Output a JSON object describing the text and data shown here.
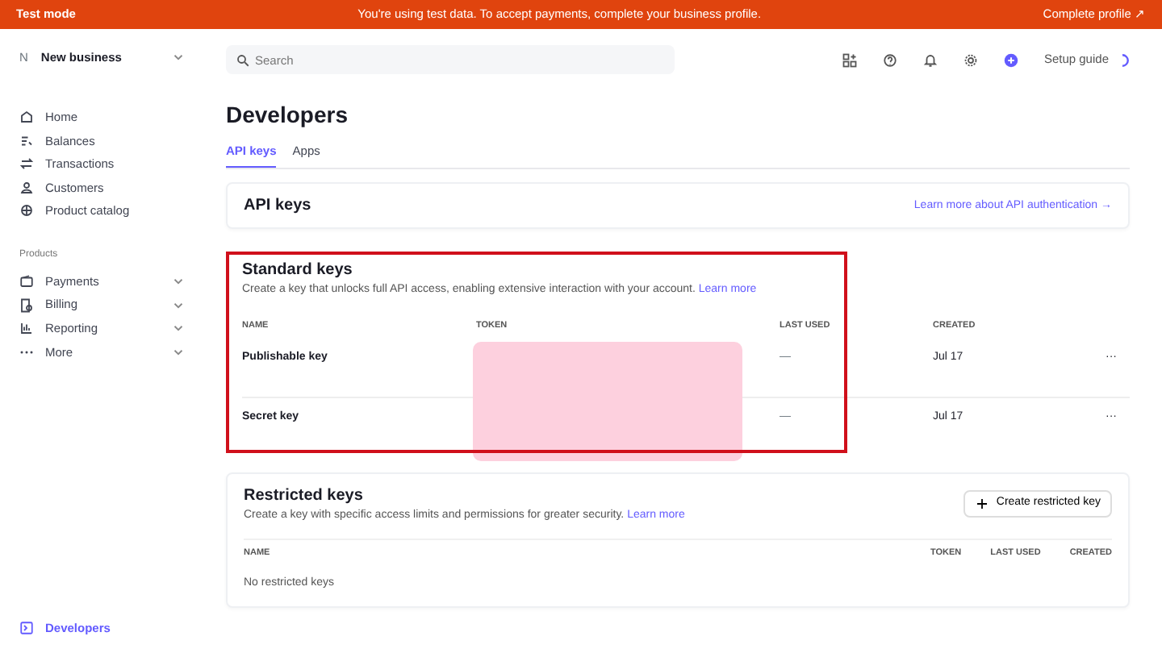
{
  "banner": {
    "mode": "Test mode",
    "message": "You're using test data. To accept payments, complete your business profile.",
    "action": "Complete profile ↗"
  },
  "account": {
    "initial": "N",
    "name": "New business"
  },
  "sidebar": {
    "items": [
      {
        "label": "Home",
        "selected": false
      },
      {
        "label": "Balances",
        "selected": false
      },
      {
        "label": "Transactions",
        "selected": false
      },
      {
        "label": "Customers",
        "selected": false
      },
      {
        "label": "Product catalog",
        "selected": false
      }
    ],
    "section_title": "Products",
    "products": [
      {
        "label": "Payments",
        "selected": false
      },
      {
        "label": "Billing",
        "selected": false
      },
      {
        "label": "Reporting",
        "selected": false
      },
      {
        "label": "More",
        "selected": false
      }
    ],
    "footer_item": {
      "label": "Developers",
      "selected": true
    }
  },
  "search": {
    "placeholder": "Search"
  },
  "toolbar": {
    "setup_guide": "Setup guide"
  },
  "page": {
    "title": "Developers",
    "tabs": [
      {
        "label": "API keys",
        "selected": true
      },
      {
        "label": "Apps",
        "selected": false
      }
    ]
  },
  "api_keys": {
    "title": "API keys",
    "link": "Learn more about API authentication →"
  },
  "standard_keys": {
    "title": "Standard keys",
    "description": "Create a key that unlocks full API access, enabling extensive interaction with your account.",
    "link": "Learn more",
    "columns": [
      "NAME",
      "TOKEN",
      "LAST USED",
      "CREATED"
    ],
    "rows": [
      {
        "name": "Publishable key",
        "last_used": "—",
        "created": "Jul 17",
        "menu": "···"
      },
      {
        "name": "Secret key",
        "last_used": "—",
        "created": "Jul 17",
        "menu": "···"
      }
    ]
  },
  "restricted_keys": {
    "title": "Restricted keys",
    "description": "Create a key with specific access limits and permissions for greater security.",
    "link": "Learn more",
    "button": "Create restricted key",
    "columns": [
      "NAME",
      "TOKEN",
      "LAST USED",
      "CREATED"
    ],
    "empty": "No restricted keys"
  }
}
